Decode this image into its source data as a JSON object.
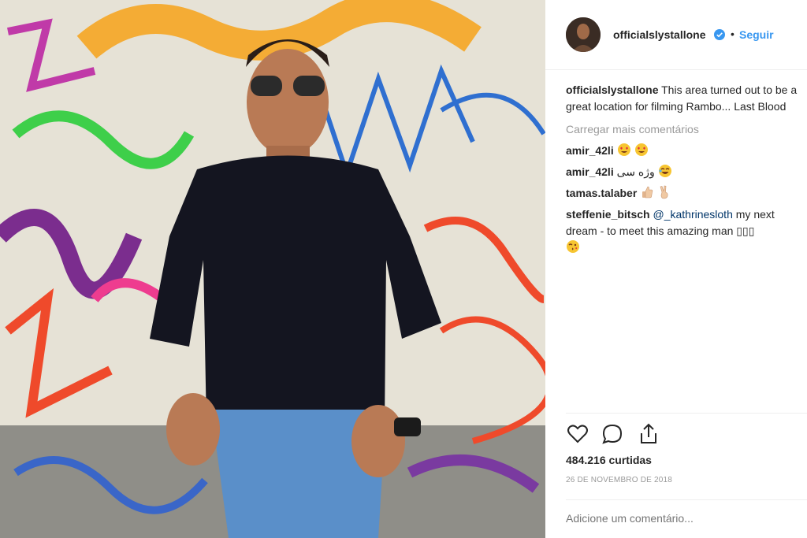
{
  "post": {
    "username": "officialslystallone",
    "follow_label": "Seguir",
    "dot": "•"
  },
  "caption": {
    "username": "officialslystallone",
    "line1": "This area turned out to be a",
    "line2": "great location for filming Rambo... Last Blood"
  },
  "load_more": "Carregar mais comentários",
  "comments": [
    {
      "user": "amir_42li",
      "text": "",
      "emojis": [
        "heart-eyes",
        "heart-eyes"
      ]
    },
    {
      "user": "amir_42li",
      "text": "وژه سی",
      "emojis": [
        "laughing"
      ]
    },
    {
      "user": "tamas.talaber",
      "text": "",
      "emojis": [
        "thumbs-up",
        "victory-hand"
      ]
    },
    {
      "user": "steffenie_bitsch",
      "mention": "@_kathrinesloth",
      "text": "my next",
      "text2": "dream - to meet this amazing man ▯▯▯",
      "emojis": [
        "kiss-wink"
      ]
    }
  ],
  "likes_text": "484.216 curtidas",
  "date_text": "26 DE NOVEMBRO DE 2018",
  "add_comment_placeholder": "Adicione um comentário...",
  "colors": {
    "link": "#3897f0",
    "muted": "#999999",
    "text": "#262626",
    "verified": "#3897f0"
  },
  "icons": [
    "heart-icon",
    "comment-icon",
    "share-icon",
    "verified-badge-icon"
  ]
}
